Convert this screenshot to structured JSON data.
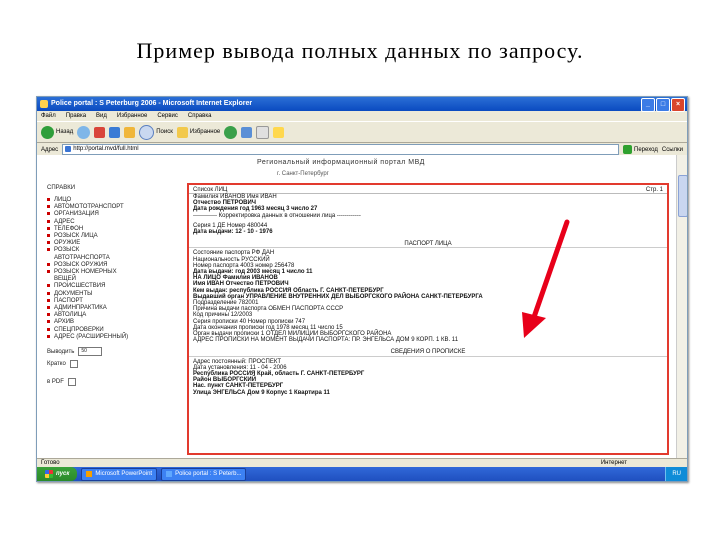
{
  "slide": {
    "title": "Пример вывода полных данных по запросу."
  },
  "window": {
    "title": "Police portal : S Peterburg 2006 - Microsoft Internet Explorer",
    "menu": [
      "Файл",
      "Правка",
      "Вид",
      "Избранное",
      "Сервис",
      "Справка"
    ],
    "toolbar": {
      "back": "Назад",
      "search": "Поиск",
      "favorites": "Избранное"
    },
    "address": {
      "label": "Адрес",
      "value": "http://portal.mvd/full.html",
      "go": "Переход",
      "links": "Ссылки"
    }
  },
  "portal": {
    "title": "Региональный информационный портал МВД",
    "subtitle": "г. Санкт-Петербург"
  },
  "sidebar": {
    "head": "СПРАВКИ",
    "items": [
      {
        "label": "ЛИЦО",
        "sub": false
      },
      {
        "label": "АВТОМОТОТРАНСПОРТ",
        "sub": false
      },
      {
        "label": "ОРГАНИЗАЦИЯ",
        "sub": false
      },
      {
        "label": "АДРЕС",
        "sub": false
      },
      {
        "label": "ТЕЛЕФОН",
        "sub": false
      },
      {
        "label": "РОЗЫСК ЛИЦА",
        "sub": false
      },
      {
        "label": "ОРУЖИЕ",
        "sub": false
      },
      {
        "label": "РОЗЫСК",
        "sub": false
      },
      {
        "label": "АВТОТРАНСПОРТА",
        "sub": true
      },
      {
        "label": "РОЗЫСК ОРУЖИЯ",
        "sub": false
      },
      {
        "label": "РОЗЫСК НОМЕРНЫХ",
        "sub": false
      },
      {
        "label": "ВЕЩЕЙ",
        "sub": true
      },
      {
        "label": "ПРОИСШЕСТВИЯ",
        "sub": false
      },
      {
        "label": "ДОКУМЕНТЫ",
        "sub": false
      },
      {
        "label": "ПАСПОРТ",
        "sub": false
      },
      {
        "label": "АДМИНПРАКТИКА",
        "sub": false
      },
      {
        "label": "АВТОЛИЦА",
        "sub": false
      },
      {
        "label": "АРХИВ",
        "sub": false
      },
      {
        "label": "СПЕЦПРОВЕРКИ",
        "sub": false
      },
      {
        "label": "АДРЕС (РАСШИРЕННЫЙ)",
        "sub": false
      }
    ],
    "form": {
      "count_label": "Выводить",
      "count_value": "50",
      "short_label": "Кратко",
      "pdf_label": "в PDF"
    }
  },
  "result": {
    "header_left": "Список ЛИЦ",
    "header_right": "Стр. 1",
    "lines": [
      {
        "text": "Фамилия ИВАНОВ  Имя ИВАН",
        "bold": false
      },
      {
        "text": "Отчество ПЕТРОВИЧ",
        "bold": true
      },
      {
        "text": "Дата рождения год 1963  месяц 3  число 27",
        "bold": true
      },
      {
        "text": "------------ Корректировка данных в отношении лица ------------",
        "bold": false
      },
      {
        "text": "",
        "bold": false
      },
      {
        "text": "Серия 1 ДЕ  Номер 480044",
        "bold": false
      },
      {
        "text": "Дата выдачи: 12 - 10 - 1976",
        "bold": true
      },
      {
        "text": "",
        "bold": false
      },
      {
        "text": "ПАСПОРТ ЛИЦА",
        "center": true
      },
      {
        "text": "Состояние паспорта РФ ДАН",
        "bold": false
      },
      {
        "text": "Национальность РУССКИЙ",
        "bold": false
      },
      {
        "text": "Номер паспорта 4003  номер 256478",
        "bold": false
      },
      {
        "text": "Дата выдачи: год 2003  месяц 1  число 11",
        "bold": true
      },
      {
        "text": "НА ЛИЦО  Фамилия ИВАНОВ",
        "bold": true
      },
      {
        "text": "Имя ИВАН  Отчество ПЕТРОВИЧ",
        "bold": true
      },
      {
        "text": "Кем выдан: республика РОССИЯ  Область  Г. САНКТ-ПЕТЕРБУРГ",
        "bold": true
      },
      {
        "text": "Выдавший орган УПРАВЛЕНИЕ ВНУТРЕННИХ ДЕЛ ВЫБОРГСКОГО РАЙОНА САНКТ-ПЕТЕРБУРГА",
        "bold": true
      },
      {
        "text": "Подразделение 782001",
        "bold": false
      },
      {
        "text": "Причина выдачи паспорта ОБМЕН ПАСПОРТА СССР",
        "bold": false
      },
      {
        "text": "Код причины 12/2003",
        "bold": false
      },
      {
        "text": "Серия прописки 40  Номер прописки 747",
        "bold": false
      },
      {
        "text": "Дата окончания прописки год 1978  месяц 11  число 15",
        "bold": false
      },
      {
        "text": "Орган выдачи прописки 1 ОТДЕЛ МИЛИЦИИ ВЫБОРГСКОГО РАЙОНА",
        "bold": false
      },
      {
        "text": "АДРЕС ПРОПИСКИ НА МОМЕНТ ВЫДАЧИ ПАСПОРТА: ПР. ЭНГЕЛЬСА ДОМ 9 КОРП. 1 КВ. 11",
        "bold": false
      },
      {
        "text": "",
        "bold": false
      },
      {
        "text": "СВЕДЕНИЯ О ПРОПИСКЕ",
        "center": true
      },
      {
        "text": "Адрес постоянный: ПРОСПЕКТ",
        "bold": false
      },
      {
        "text": "Дата установления: 11 - 04 - 2006",
        "bold": false
      },
      {
        "text": "Республика РОССИЯ  Край, область Г. САНКТ-ПЕТЕРБУРГ",
        "bold": true
      },
      {
        "text": "Район ВЫБОРГСКИЙ",
        "bold": true
      },
      {
        "text": "Нас. пункт САНКТ-ПЕТЕРБУРГ",
        "bold": true
      },
      {
        "text": "Улица ЭНГЕЛЬСА  Дом 9  Корпус 1  Квартира 11",
        "bold": true
      }
    ]
  },
  "status": {
    "left": "Готово",
    "zone": "Интернет"
  },
  "taskbar": {
    "start": "пуск",
    "tasks": [
      "Microsoft PowerPoint",
      "Police portal : S Peterb..."
    ],
    "tray": "RU"
  },
  "colors": {
    "highlight": "#e23a2e",
    "arrow": "#e8001a"
  }
}
